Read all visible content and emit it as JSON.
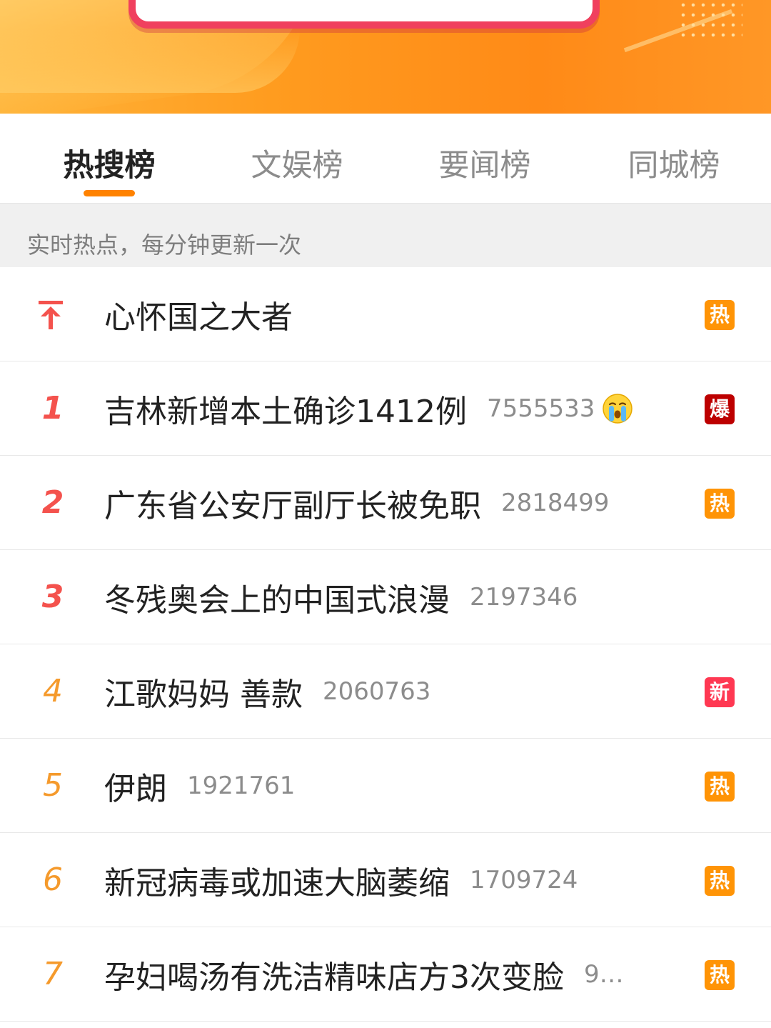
{
  "tabs": [
    {
      "label": "热搜榜",
      "active": true
    },
    {
      "label": "文娱榜",
      "active": false
    },
    {
      "label": "要闻榜",
      "active": false
    },
    {
      "label": "同城榜",
      "active": false
    }
  ],
  "info_text": "实时热点，每分钟更新一次",
  "badge_colors": {
    "热": "#ff9406",
    "爆": "#bd0000",
    "新": "#ff3852"
  },
  "rank_colors": {
    "top": "#f4524d",
    "rest": "#f59a2c"
  },
  "items": [
    {
      "rank": "",
      "pinned": true,
      "title": "心怀国之大者",
      "count": "",
      "emoji": "",
      "badge": "热"
    },
    {
      "rank": "1",
      "pinned": false,
      "title": "吉林新增本土确诊1412例",
      "count": "7555533",
      "emoji": "crying-face-icon",
      "badge": "爆"
    },
    {
      "rank": "2",
      "pinned": false,
      "title": "广东省公安厅副厅长被免职",
      "count": "2818499",
      "emoji": "",
      "badge": "热"
    },
    {
      "rank": "3",
      "pinned": false,
      "title": "冬残奥会上的中国式浪漫",
      "count": "2197346",
      "emoji": "",
      "badge": ""
    },
    {
      "rank": "4",
      "pinned": false,
      "title": "江歌妈妈 善款",
      "count": "2060763",
      "emoji": "",
      "badge": "新"
    },
    {
      "rank": "5",
      "pinned": false,
      "title": "伊朗",
      "count": "1921761",
      "emoji": "",
      "badge": "热"
    },
    {
      "rank": "6",
      "pinned": false,
      "title": "新冠病毒或加速大脑萎缩",
      "count": "1709724",
      "emoji": "",
      "badge": "热"
    },
    {
      "rank": "7",
      "pinned": false,
      "title": "孕妇喝汤有洗洁精味店方3次变脸",
      "count": "9…",
      "emoji": "",
      "badge": "热"
    }
  ]
}
